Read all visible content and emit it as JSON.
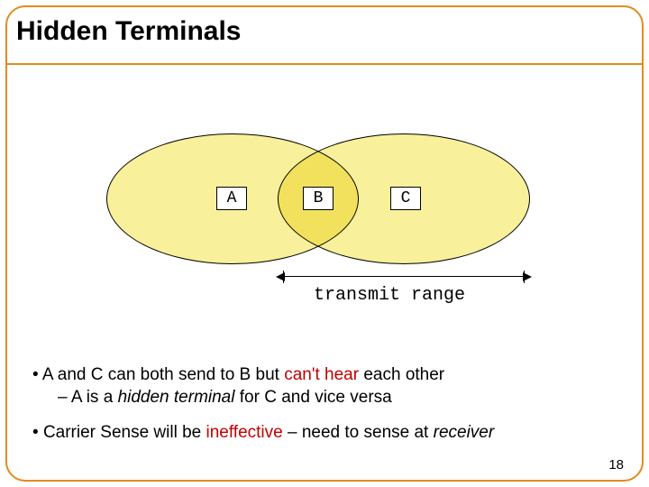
{
  "title": "Hidden Terminals",
  "nodes": {
    "a": "A",
    "b": "B",
    "c": "C"
  },
  "range_label": "transmit range",
  "bullets": {
    "b1_pre": "A and C can both send to B but ",
    "b1_cant": "can't hear",
    "b1_post": " each other",
    "b1_sub_pre": "A is a ",
    "b1_sub_term": "hidden terminal",
    "b1_sub_post": " for C and vice versa",
    "b2_pre": "Carrier Sense will be ",
    "b2_ineff": "ineffective",
    "b2_mid": " – need to sense at ",
    "b2_recv": "receiver"
  },
  "page_number": "18"
}
